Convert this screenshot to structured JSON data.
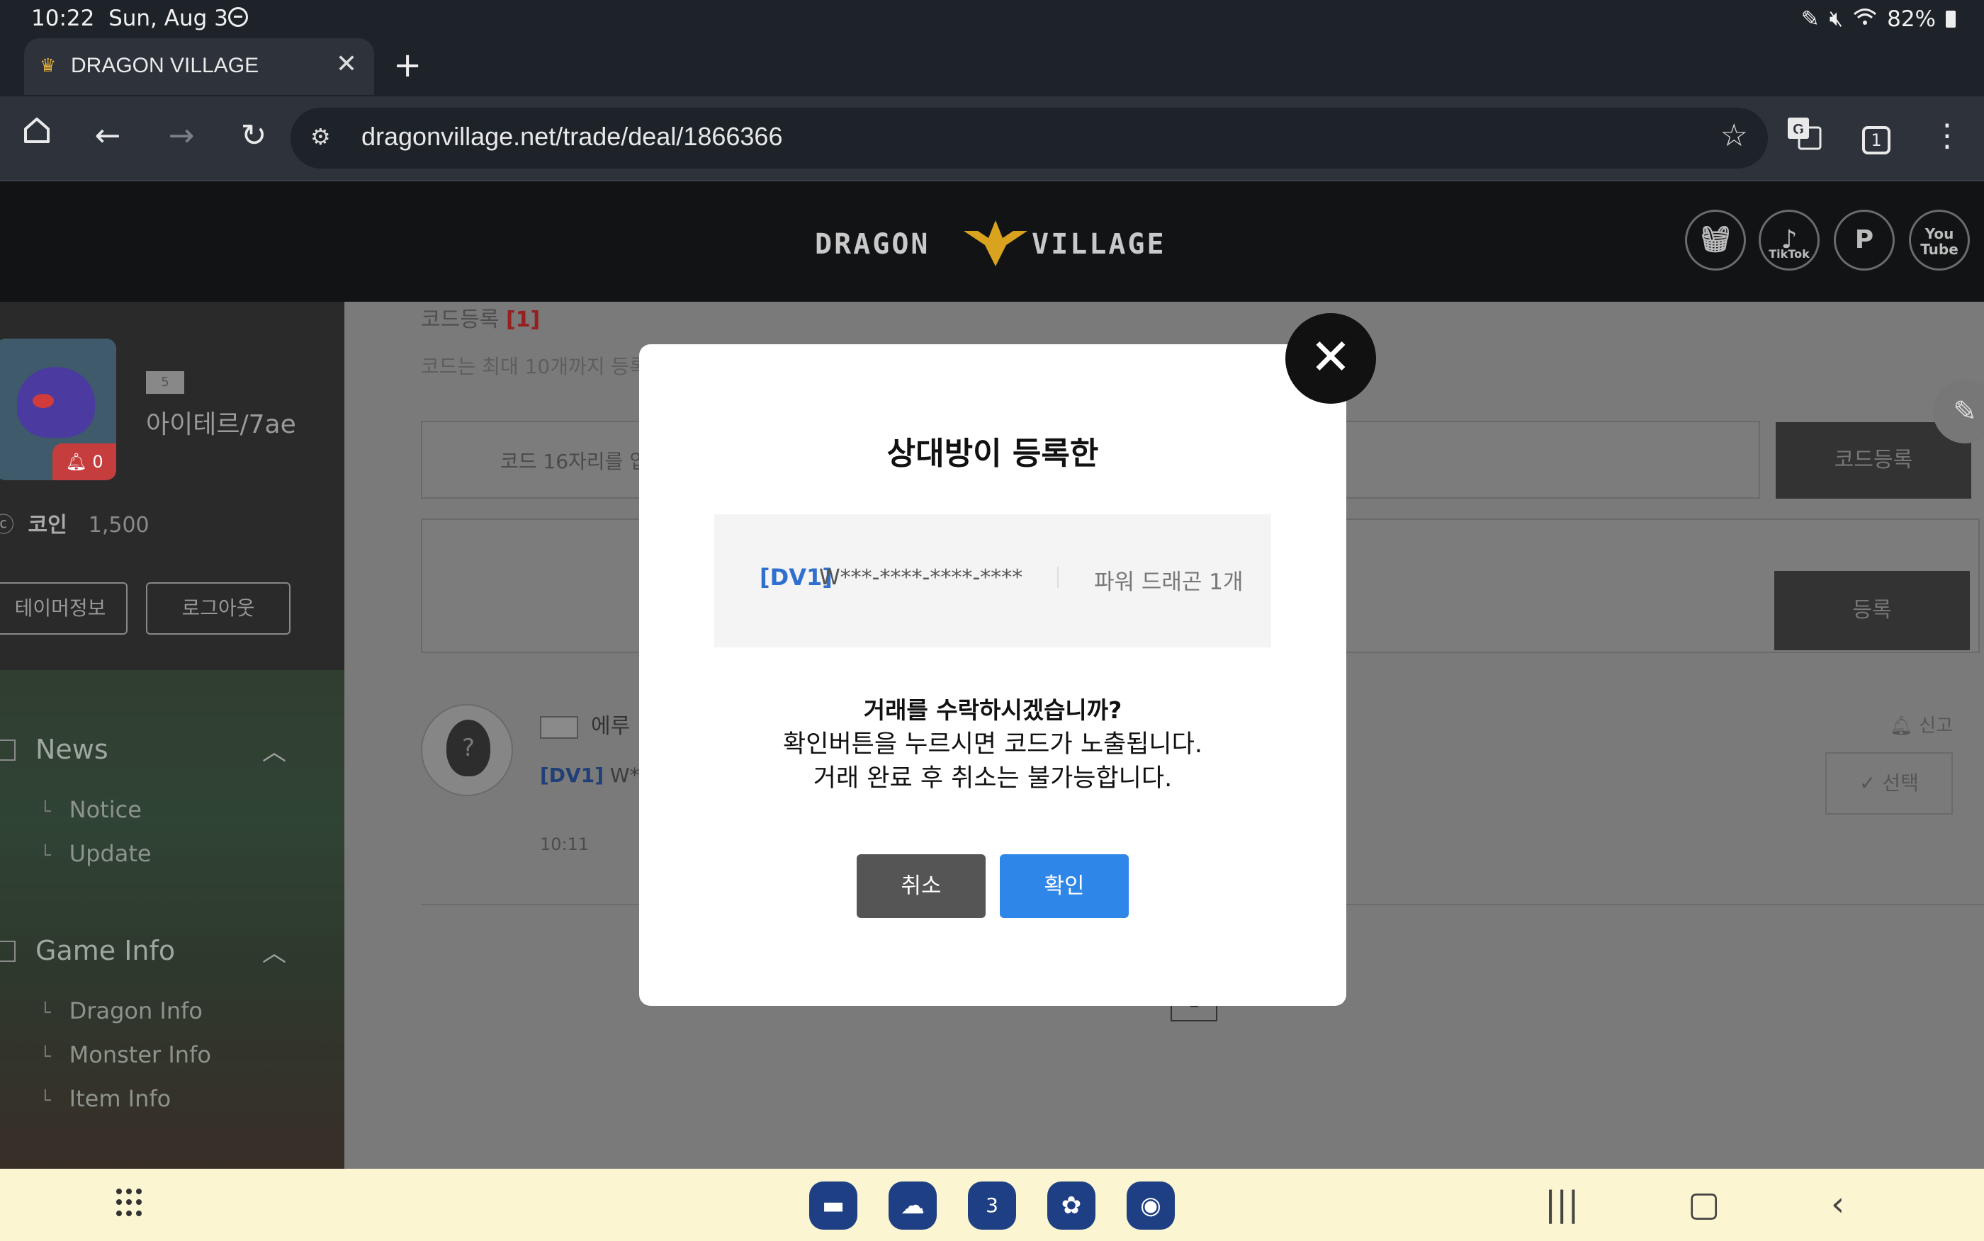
{
  "status_bar": {
    "time": "10:22",
    "date": "Sun, Aug 3",
    "battery": "82%"
  },
  "browser": {
    "tab_title": "DRAGON VILLAGE",
    "url": "dragonvillage.net/trade/deal/1866366",
    "tab_count": "1"
  },
  "site": {
    "logo_left": "DRAGON",
    "logo_right": "VILLAGE",
    "social": [
      "shop-basket-icon",
      "tiktok-icon",
      "p-icon",
      "youtube-icon"
    ],
    "tiktok_label": "TikTok",
    "youtube_label": "You Tube"
  },
  "sidebar": {
    "level": "5",
    "nickname": "아이테르/7ae",
    "bell_count": "0",
    "coin_label": "코인",
    "coin_value": "1,500",
    "tamer_info": "테이머정보",
    "logout": "로그아웃",
    "sections": [
      {
        "title": "News",
        "items": [
          "Notice",
          "Update"
        ]
      },
      {
        "title": "Game Info",
        "items": [
          "Dragon Info",
          "Monster Info",
          "Item Info"
        ]
      }
    ]
  },
  "main": {
    "title": "코드등록",
    "title_count": "[1]",
    "desc": "코드는 최대 10개까지 등록",
    "input_placeholder": "코드 16자리를 입",
    "code_register": "코드등록",
    "register": "등록",
    "entry_name": "에루",
    "entry_code_tag": "[DV1]",
    "entry_code": "W***-",
    "entry_time": "10:11",
    "report": "신고",
    "select": "선택",
    "page": "1"
  },
  "modal": {
    "title": "상대방이 등록한",
    "code_tag": "[DV1]",
    "code_masked": "W***-****-****-****",
    "item": "파워 드래곤 1개",
    "question": "거래를 수락하시겠습니까?",
    "line1": "확인버튼을 누르시면 코드가 노출됩니다.",
    "line2": "거래 완료 후 취소는 불가능합니다.",
    "cancel": "취소",
    "confirm": "확인"
  },
  "taskbar": {
    "calendar_day": "3"
  }
}
